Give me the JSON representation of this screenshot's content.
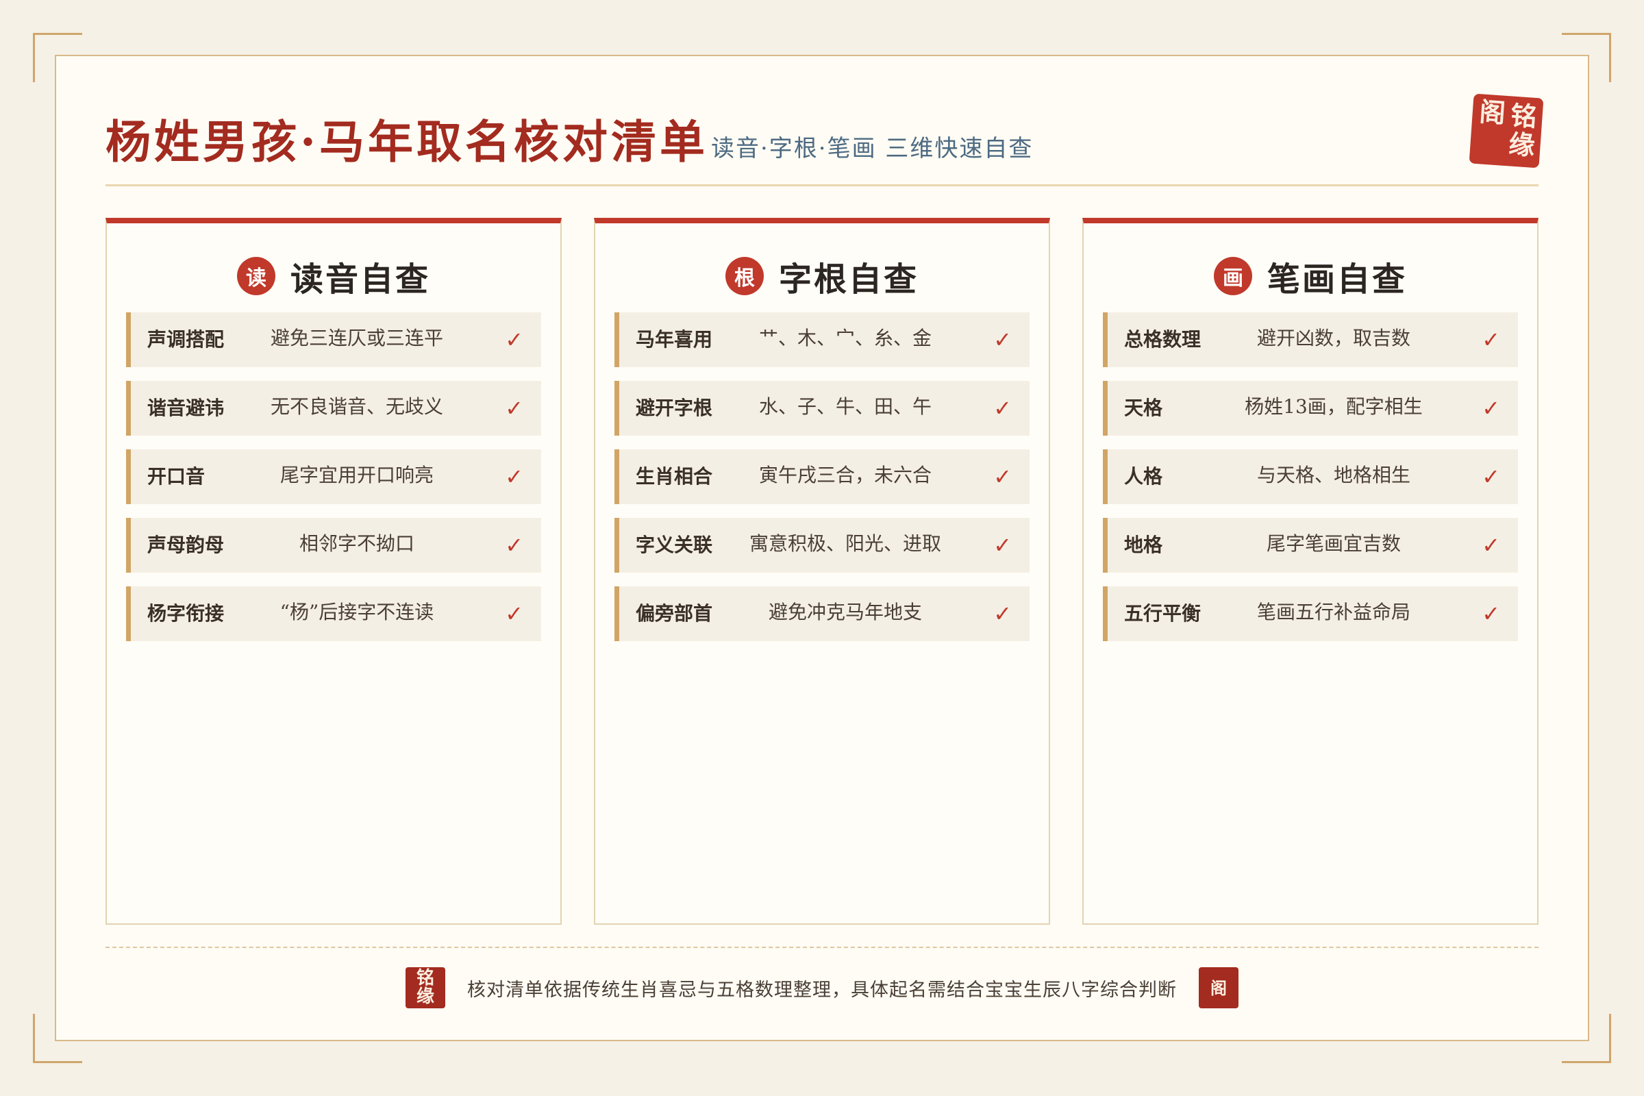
{
  "header": {
    "title": "杨姓男孩·马年取名核对清单",
    "subtitle": "读音·字根·笔画 三维快速自查",
    "seal": [
      "铭",
      "缘",
      "阁"
    ]
  },
  "cards": [
    {
      "badge": "读",
      "title": "读音自查",
      "rows": [
        {
          "label": "声调搭配",
          "value": "避免三连仄或三连平",
          "check": "✓"
        },
        {
          "label": "谐音避讳",
          "value": "无不良谐音、无歧义",
          "check": "✓"
        },
        {
          "label": "开口音",
          "value": "尾字宜用开口响亮",
          "check": "✓"
        },
        {
          "label": "声母韵母",
          "value": "相邻字不拗口",
          "check": "✓"
        },
        {
          "label": "杨字衔接",
          "value": "“杨”后接字不连读",
          "check": "✓"
        }
      ]
    },
    {
      "badge": "根",
      "title": "字根自查",
      "rows": [
        {
          "label": "马年喜用",
          "value": "艹、木、宀、糸、金",
          "check": "✓"
        },
        {
          "label": "避开字根",
          "value": "水、子、牛、田、午",
          "check": "✓"
        },
        {
          "label": "生肖相合",
          "value": "寅午戌三合，未六合",
          "check": "✓"
        },
        {
          "label": "字义关联",
          "value": "寓意积极、阳光、进取",
          "check": "✓"
        },
        {
          "label": "偏旁部首",
          "value": "避免冲克马年地支",
          "check": "✓"
        }
      ]
    },
    {
      "badge": "画",
      "title": "笔画自查",
      "rows": [
        {
          "label": "总格数理",
          "value": "避开凶数，取吉数",
          "check": "✓"
        },
        {
          "label": "天格",
          "value": "杨姓13画，配字相生",
          "check": "✓"
        },
        {
          "label": "人格",
          "value": "与天格、地格相生",
          "check": "✓"
        },
        {
          "label": "地格",
          "value": "尾字笔画宜吉数",
          "check": "✓"
        },
        {
          "label": "五行平衡",
          "value": "笔画五行补益命局",
          "check": "✓"
        }
      ]
    }
  ],
  "footer": {
    "seal_left": [
      "铭",
      "缘"
    ],
    "note": "核对清单依据传统生肖喜忌与五格数理整理，具体起名需结合宝宝生辰八字综合判断",
    "seal_right": "阁"
  },
  "colors": {
    "accent": "#c0392b",
    "title": "#a32b1f",
    "gold": "#d1a566",
    "subtitle": "#4d6a82"
  }
}
